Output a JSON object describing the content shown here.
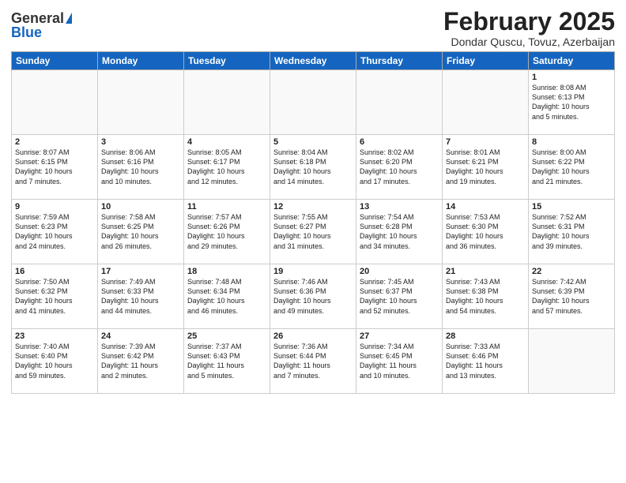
{
  "logo": {
    "general": "General",
    "blue": "Blue"
  },
  "title": "February 2025",
  "subtitle": "Dondar Quscu, Tovuz, Azerbaijan",
  "days": [
    "Sunday",
    "Monday",
    "Tuesday",
    "Wednesday",
    "Thursday",
    "Friday",
    "Saturday"
  ],
  "weeks": [
    [
      {
        "day": "",
        "content": ""
      },
      {
        "day": "",
        "content": ""
      },
      {
        "day": "",
        "content": ""
      },
      {
        "day": "",
        "content": ""
      },
      {
        "day": "",
        "content": ""
      },
      {
        "day": "",
        "content": ""
      },
      {
        "day": "1",
        "content": "Sunrise: 8:08 AM\nSunset: 6:13 PM\nDaylight: 10 hours\nand 5 minutes."
      }
    ],
    [
      {
        "day": "2",
        "content": "Sunrise: 8:07 AM\nSunset: 6:15 PM\nDaylight: 10 hours\nand 7 minutes."
      },
      {
        "day": "3",
        "content": "Sunrise: 8:06 AM\nSunset: 6:16 PM\nDaylight: 10 hours\nand 10 minutes."
      },
      {
        "day": "4",
        "content": "Sunrise: 8:05 AM\nSunset: 6:17 PM\nDaylight: 10 hours\nand 12 minutes."
      },
      {
        "day": "5",
        "content": "Sunrise: 8:04 AM\nSunset: 6:18 PM\nDaylight: 10 hours\nand 14 minutes."
      },
      {
        "day": "6",
        "content": "Sunrise: 8:02 AM\nSunset: 6:20 PM\nDaylight: 10 hours\nand 17 minutes."
      },
      {
        "day": "7",
        "content": "Sunrise: 8:01 AM\nSunset: 6:21 PM\nDaylight: 10 hours\nand 19 minutes."
      },
      {
        "day": "8",
        "content": "Sunrise: 8:00 AM\nSunset: 6:22 PM\nDaylight: 10 hours\nand 21 minutes."
      }
    ],
    [
      {
        "day": "9",
        "content": "Sunrise: 7:59 AM\nSunset: 6:23 PM\nDaylight: 10 hours\nand 24 minutes."
      },
      {
        "day": "10",
        "content": "Sunrise: 7:58 AM\nSunset: 6:25 PM\nDaylight: 10 hours\nand 26 minutes."
      },
      {
        "day": "11",
        "content": "Sunrise: 7:57 AM\nSunset: 6:26 PM\nDaylight: 10 hours\nand 29 minutes."
      },
      {
        "day": "12",
        "content": "Sunrise: 7:55 AM\nSunset: 6:27 PM\nDaylight: 10 hours\nand 31 minutes."
      },
      {
        "day": "13",
        "content": "Sunrise: 7:54 AM\nSunset: 6:28 PM\nDaylight: 10 hours\nand 34 minutes."
      },
      {
        "day": "14",
        "content": "Sunrise: 7:53 AM\nSunset: 6:30 PM\nDaylight: 10 hours\nand 36 minutes."
      },
      {
        "day": "15",
        "content": "Sunrise: 7:52 AM\nSunset: 6:31 PM\nDaylight: 10 hours\nand 39 minutes."
      }
    ],
    [
      {
        "day": "16",
        "content": "Sunrise: 7:50 AM\nSunset: 6:32 PM\nDaylight: 10 hours\nand 41 minutes."
      },
      {
        "day": "17",
        "content": "Sunrise: 7:49 AM\nSunset: 6:33 PM\nDaylight: 10 hours\nand 44 minutes."
      },
      {
        "day": "18",
        "content": "Sunrise: 7:48 AM\nSunset: 6:34 PM\nDaylight: 10 hours\nand 46 minutes."
      },
      {
        "day": "19",
        "content": "Sunrise: 7:46 AM\nSunset: 6:36 PM\nDaylight: 10 hours\nand 49 minutes."
      },
      {
        "day": "20",
        "content": "Sunrise: 7:45 AM\nSunset: 6:37 PM\nDaylight: 10 hours\nand 52 minutes."
      },
      {
        "day": "21",
        "content": "Sunrise: 7:43 AM\nSunset: 6:38 PM\nDaylight: 10 hours\nand 54 minutes."
      },
      {
        "day": "22",
        "content": "Sunrise: 7:42 AM\nSunset: 6:39 PM\nDaylight: 10 hours\nand 57 minutes."
      }
    ],
    [
      {
        "day": "23",
        "content": "Sunrise: 7:40 AM\nSunset: 6:40 PM\nDaylight: 10 hours\nand 59 minutes."
      },
      {
        "day": "24",
        "content": "Sunrise: 7:39 AM\nSunset: 6:42 PM\nDaylight: 11 hours\nand 2 minutes."
      },
      {
        "day": "25",
        "content": "Sunrise: 7:37 AM\nSunset: 6:43 PM\nDaylight: 11 hours\nand 5 minutes."
      },
      {
        "day": "26",
        "content": "Sunrise: 7:36 AM\nSunset: 6:44 PM\nDaylight: 11 hours\nand 7 minutes."
      },
      {
        "day": "27",
        "content": "Sunrise: 7:34 AM\nSunset: 6:45 PM\nDaylight: 11 hours\nand 10 minutes."
      },
      {
        "day": "28",
        "content": "Sunrise: 7:33 AM\nSunset: 6:46 PM\nDaylight: 11 hours\nand 13 minutes."
      },
      {
        "day": "",
        "content": ""
      }
    ]
  ]
}
